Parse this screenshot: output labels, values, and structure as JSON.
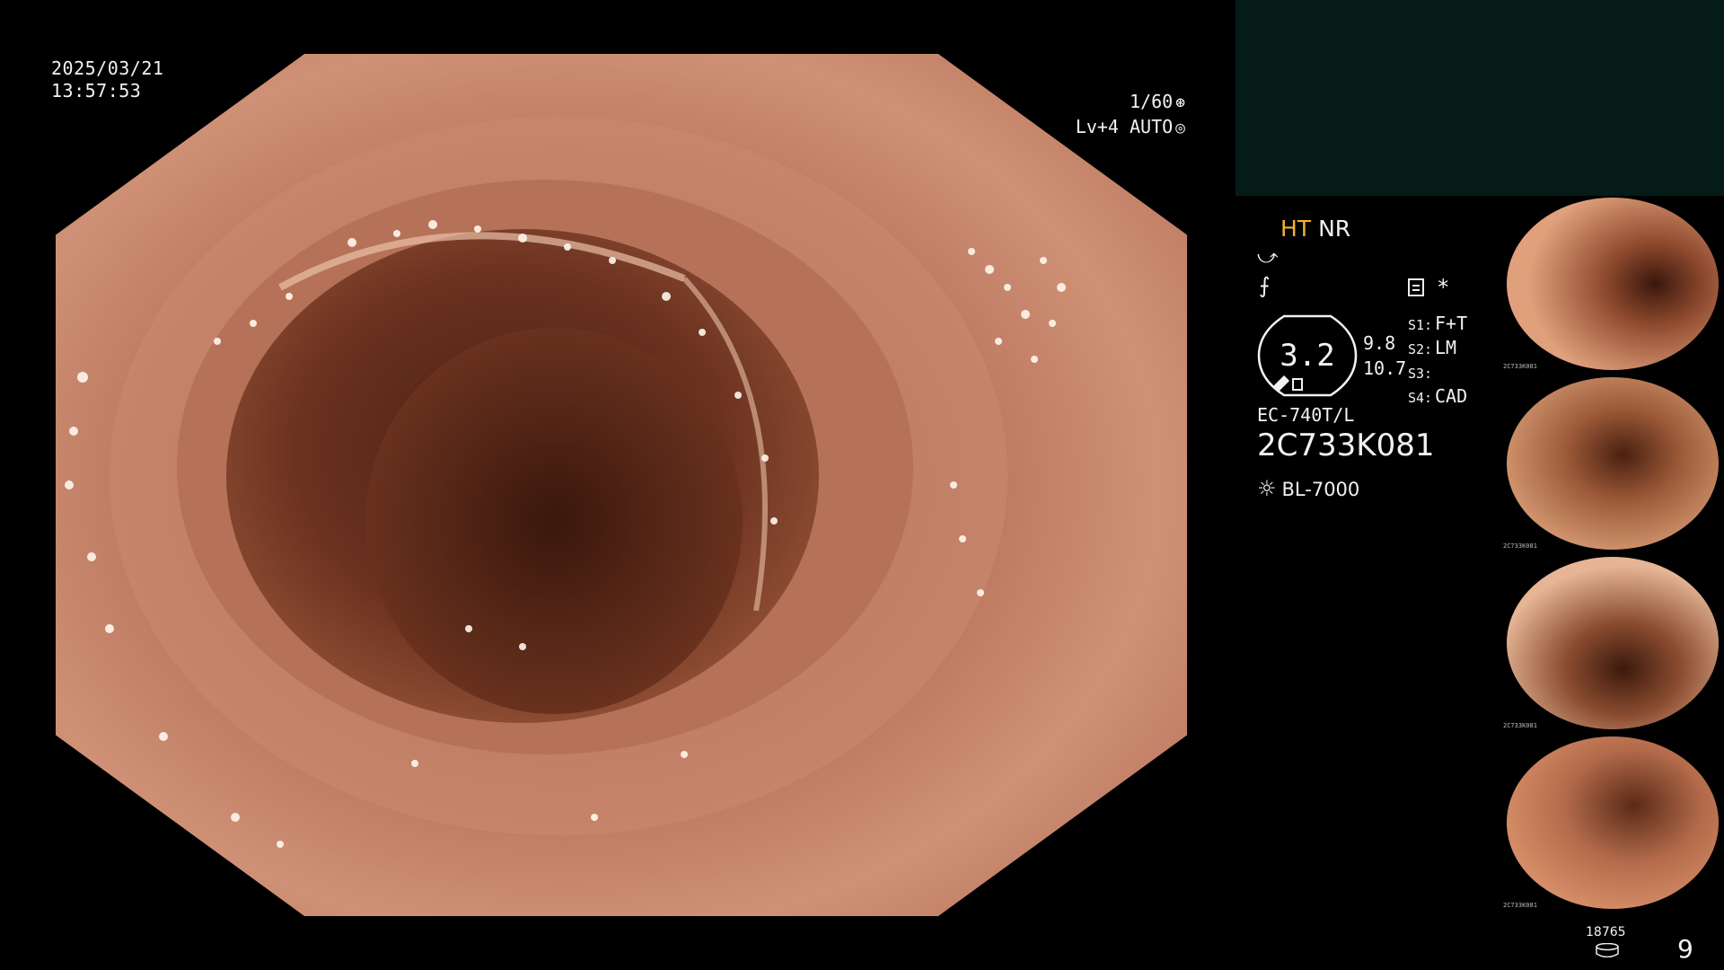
{
  "overlay": {
    "date": "2025/03/21",
    "time": "13:57:53",
    "shutter": "1/60",
    "level": "Lv+4 AUTO"
  },
  "status": {
    "ht": "HT",
    "nr": "NR",
    "enhancement_value": "3.2",
    "value_a": "9.8",
    "value_b": "10.7",
    "s1_key": "S1:",
    "s1_val": "F+T",
    "s2_key": "S2:",
    "s2_val": "LM",
    "s3_key": "S3:",
    "s3_val": "",
    "s4_key": "S4:",
    "s4_val": "CAD",
    "scope_model": "EC-740T/L",
    "scope_serial": "2C733K081",
    "light_source": "BL-7000",
    "asterisk": "*"
  },
  "thumbnails": [
    {
      "label": "2C733K081"
    },
    {
      "label": "2C733K081"
    },
    {
      "label": "2C733K081"
    },
    {
      "label": "2C733K081"
    }
  ],
  "footer": {
    "image_count": "18765",
    "page": "9"
  },
  "icons": {
    "shutter": "shutter-icon",
    "auto": "auto-iris-icon",
    "light": "sun-icon",
    "memo": "memo-icon",
    "storage": "disk-icon"
  },
  "colors": {
    "ht": "#f3b12e",
    "panel": "#041b18",
    "tissue": "#b9715a"
  }
}
